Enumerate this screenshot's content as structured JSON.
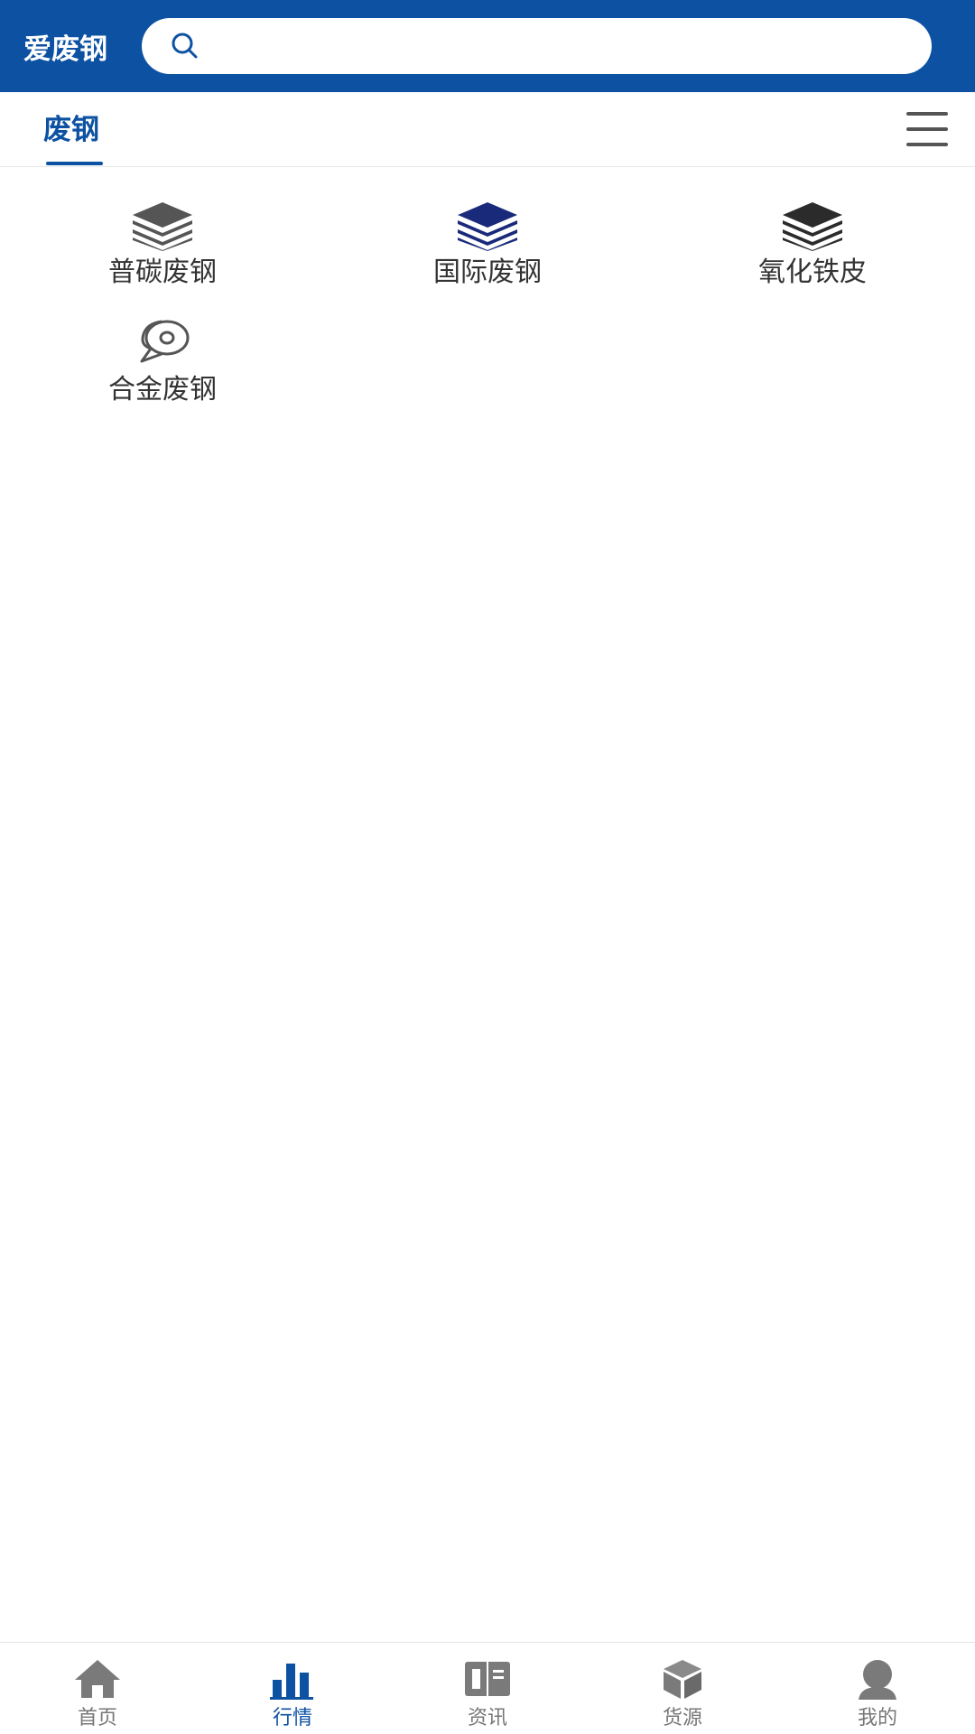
{
  "header": {
    "brand": "爱废钢",
    "search_placeholder": "",
    "color": "#0d52a2"
  },
  "tabs": {
    "active_label": "废钢"
  },
  "categories": [
    {
      "label": "普碳废钢",
      "icon": "layers-icon",
      "color": "#555555"
    },
    {
      "label": "国际废钢",
      "icon": "layers-icon",
      "color": "#1a2a7a"
    },
    {
      "label": "氧化铁皮",
      "icon": "layers-icon",
      "color": "#2b2b2b"
    },
    {
      "label": "合金废钢",
      "icon": "coil-icon",
      "color": "#555555"
    }
  ],
  "bottom_nav": [
    {
      "label": "首页",
      "icon": "home-icon",
      "active": false
    },
    {
      "label": "行情",
      "icon": "bar-chart-icon",
      "active": true
    },
    {
      "label": "资讯",
      "icon": "book-icon",
      "active": false
    },
    {
      "label": "货源",
      "icon": "box-icon",
      "active": false
    },
    {
      "label": "我的",
      "icon": "user-icon",
      "active": false
    }
  ]
}
